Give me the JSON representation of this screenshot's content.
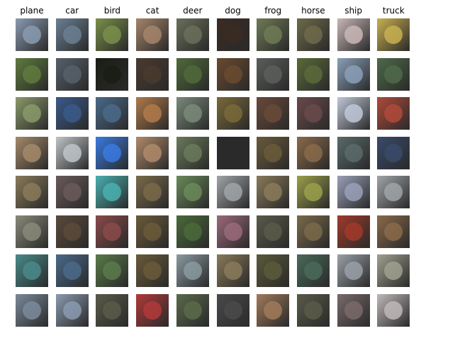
{
  "classes": [
    "plane",
    "car",
    "bird",
    "cat",
    "deer",
    "dog",
    "frog",
    "horse",
    "ship",
    "truck"
  ],
  "colors": {
    "background": "#ffffff",
    "label_text": "#000000"
  },
  "tiles": [
    [
      "#8a9bb0",
      "#6b7f93",
      "#7a8f4a",
      "#a5856a",
      "#6a6f5a",
      "#3b2b22",
      "#6f7a55",
      "#6e6a4a",
      "#c9b7b7",
      "#c8b050"
    ],
    [
      "#5f7a3e",
      "#56606a",
      "#1a1d14",
      "#4a3a2f",
      "#4f6a3a",
      "#6a4a2f",
      "#5a5e5a",
      "#5a6a3a",
      "#8aa0b8",
      "#4f6a4a"
    ],
    [
      "#8a9a6a",
      "#3a5a8a",
      "#4a6a8a",
      "#b07a4a",
      "#7a8a7a",
      "#7a6a3a",
      "#6a4a3a",
      "#6a4a4a",
      "#c0c8d8",
      "#b04a3a"
    ],
    [
      "#a58a6a",
      "#c0c4c8",
      "#3a7ae0",
      "#b08a6a",
      "#6a7a5a",
      "#2a2a2a",
      "#6a5a3a",
      "#8a6a4a",
      "#5a6a6a",
      "#3a4a6a"
    ],
    [
      "#8a7a5a",
      "#6a5a5a",
      "#4ab0b0",
      "#7a6a4a",
      "#6a8a5a",
      "#a0a4a8",
      "#8a7a5a",
      "#9aa04a",
      "#9aa0b8",
      "#a0a4a8"
    ],
    [
      "#8a8a7a",
      "#5a4a3a",
      "#8a4a4a",
      "#6a5a3a",
      "#4a6a3a",
      "#9a6a7a",
      "#5a5a4a",
      "#7a6a4a",
      "#a03a2a",
      "#8a6a4a"
    ],
    [
      "#4a8a8a",
      "#4a6a8a",
      "#5a7a4a",
      "#6a5a3a",
      "#8a9aa0",
      "#8a7a5a",
      "#5a5a3a",
      "#4a6a5a",
      "#9aa0a8",
      "#a0a090"
    ],
    [
      "#7a8a9a",
      "#8a9ab0",
      "#5a5a4a",
      "#b03a3a",
      "#5a6a4a",
      "#4a4a4a",
      "#a07a5a",
      "#5a5a4a",
      "#7a6a6a",
      "#c0b8b8"
    ]
  ]
}
